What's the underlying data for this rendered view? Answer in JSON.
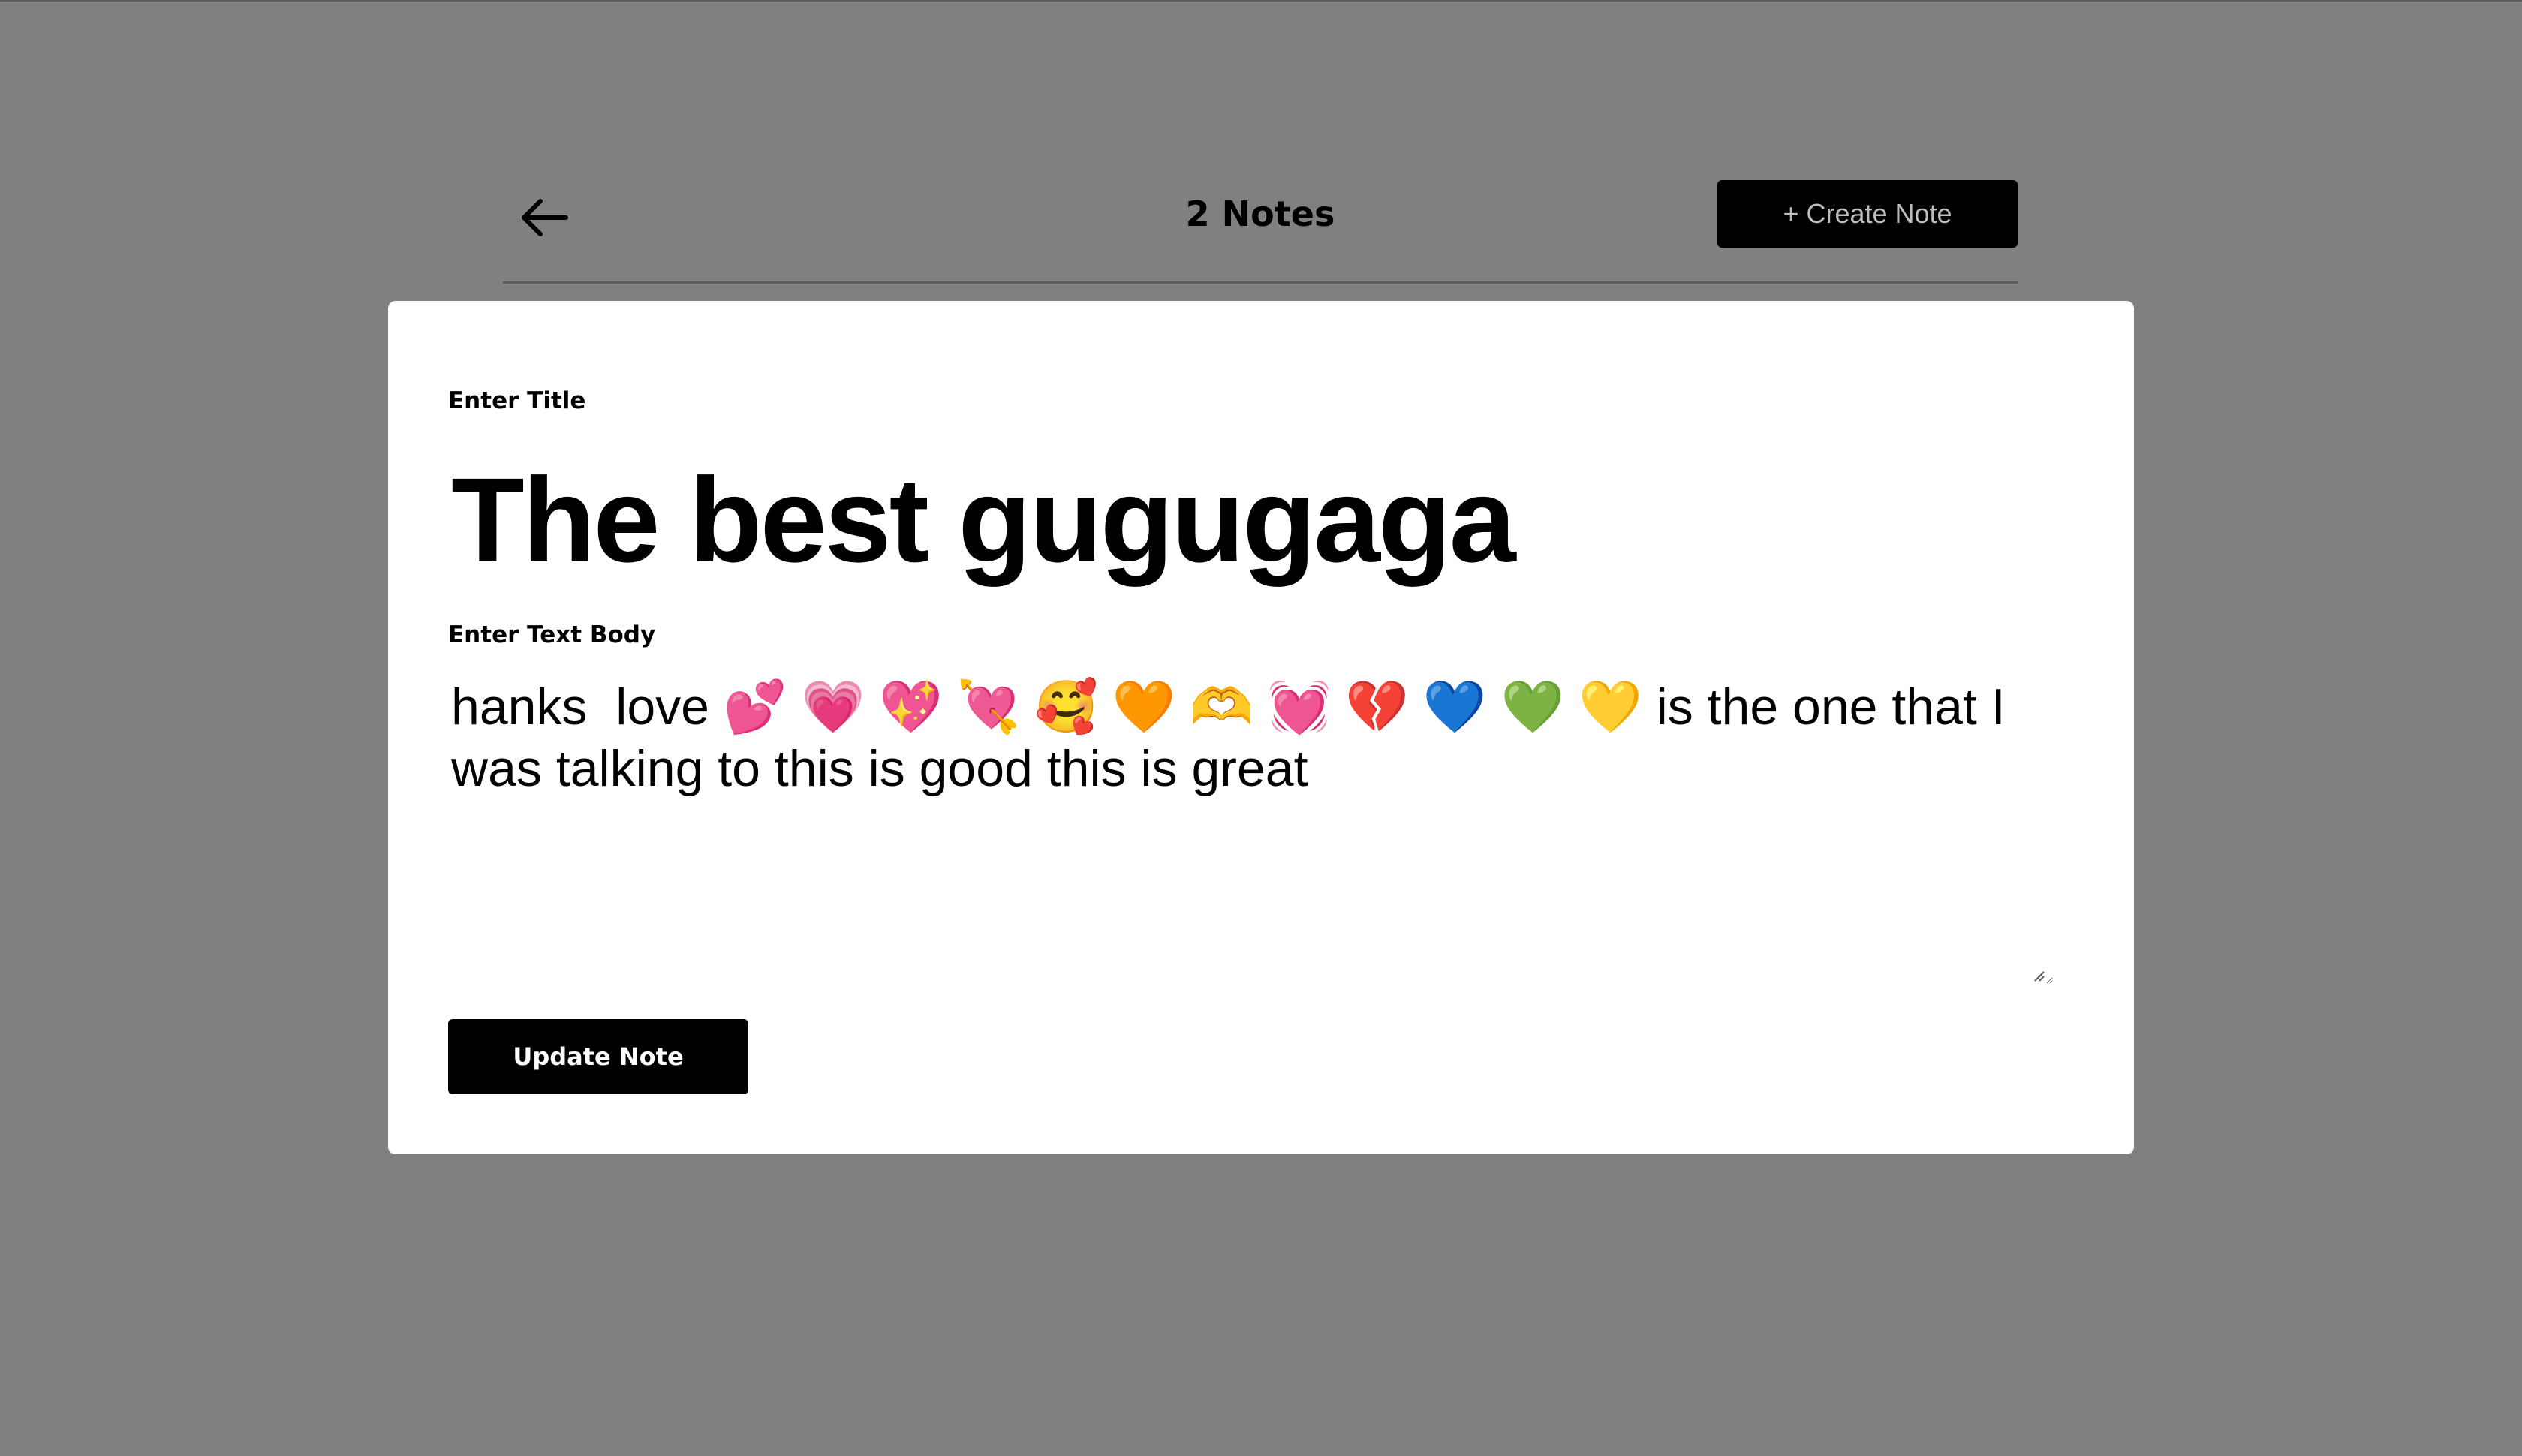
{
  "header": {
    "back_icon": "arrow-left-icon",
    "title": "2 Notes",
    "create_label": "+ Create Note"
  },
  "modal": {
    "title_label": "Enter Title",
    "title_value": "The best gugugaga",
    "body_label": "Enter Text Body",
    "body_value": "hanks  love 💕 💗 💖 💘 🥰 🧡 🫶 💓 💔 💙 💚 💛 is the one that I was talking to this is good this is great",
    "update_label": "Update Note"
  },
  "colors": {
    "backdrop": "#808080",
    "modal_bg": "#ffffff",
    "button_bg": "#000000",
    "create_text": "#bdbdbd",
    "update_text": "#ffffff"
  }
}
